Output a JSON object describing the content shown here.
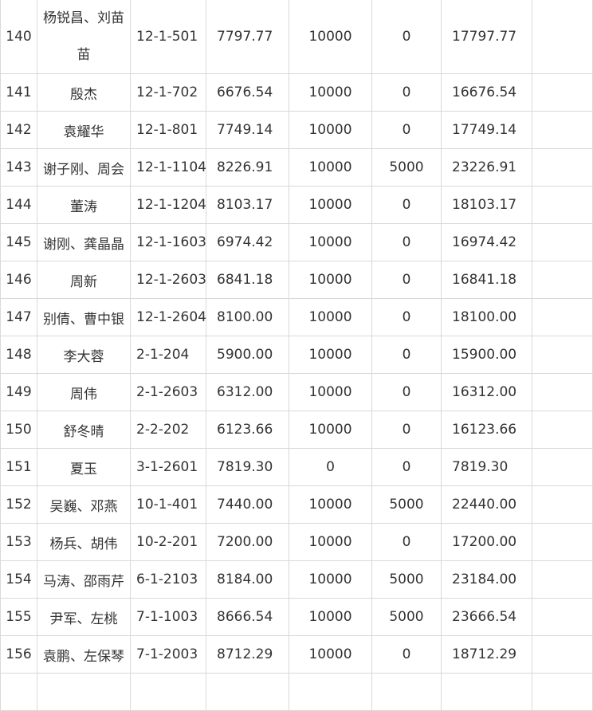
{
  "rows": [
    {
      "no": "140",
      "name": "杨锐昌、刘苗苗",
      "unit": "12-1-501",
      "amount1": "7797.77",
      "amount2": "10000",
      "amount3": "0",
      "total": "17797.77"
    },
    {
      "no": "141",
      "name": "殷杰",
      "unit": "12-1-702",
      "amount1": "6676.54",
      "amount2": "10000",
      "amount3": "0",
      "total": "16676.54"
    },
    {
      "no": "142",
      "name": "袁耀华",
      "unit": "12-1-801",
      "amount1": "7749.14",
      "amount2": "10000",
      "amount3": "0",
      "total": "17749.14"
    },
    {
      "no": "143",
      "name": "谢子刚、周会",
      "unit": "12-1-1104",
      "amount1": "8226.91",
      "amount2": "10000",
      "amount3": "5000",
      "total": "23226.91"
    },
    {
      "no": "144",
      "name": "董涛",
      "unit": "12-1-1204",
      "amount1": "8103.17",
      "amount2": "10000",
      "amount3": "0",
      "total": "18103.17"
    },
    {
      "no": "145",
      "name": "谢刚、龚晶晶",
      "unit": "12-1-1603",
      "amount1": "6974.42",
      "amount2": "10000",
      "amount3": "0",
      "total": "16974.42"
    },
    {
      "no": "146",
      "name": "周新",
      "unit": "12-1-2603",
      "amount1": "6841.18",
      "amount2": "10000",
      "amount3": "0",
      "total": "16841.18"
    },
    {
      "no": "147",
      "name": "别倩、曹中银",
      "unit": "12-1-2604",
      "amount1": "8100.00",
      "amount2": "10000",
      "amount3": "0",
      "total": "18100.00"
    },
    {
      "no": "148",
      "name": "李大蓉",
      "unit": "2-1-204",
      "amount1": "5900.00",
      "amount2": "10000",
      "amount3": "0",
      "total": "15900.00"
    },
    {
      "no": "149",
      "name": "周伟",
      "unit": "2-1-2603",
      "amount1": "6312.00",
      "amount2": "10000",
      "amount3": "0",
      "total": "16312.00"
    },
    {
      "no": "150",
      "name": "舒冬晴",
      "unit": "2-2-202",
      "amount1": "6123.66",
      "amount2": "10000",
      "amount3": "0",
      "total": "16123.66"
    },
    {
      "no": "151",
      "name": "夏玉",
      "unit": "3-1-2601",
      "amount1": "7819.30",
      "amount2": "0",
      "amount3": "0",
      "total": "7819.30"
    },
    {
      "no": "152",
      "name": "吴巍、邓燕",
      "unit": "10-1-401",
      "amount1": "7440.00",
      "amount2": "10000",
      "amount3": "5000",
      "total": "22440.00"
    },
    {
      "no": "153",
      "name": "杨兵、胡伟",
      "unit": "10-2-201",
      "amount1": "7200.00",
      "amount2": "10000",
      "amount3": "0",
      "total": "17200.00"
    },
    {
      "no": "154",
      "name": "马涛、邵雨芹",
      "unit": "6-1-2103",
      "amount1": "8184.00",
      "amount2": "10000",
      "amount3": "5000",
      "total": "23184.00"
    },
    {
      "no": "155",
      "name": "尹军、左桃",
      "unit": "7-1-1003",
      "amount1": "8666.54",
      "amount2": "10000",
      "amount3": "5000",
      "total": "23666.54"
    },
    {
      "no": "156",
      "name": "袁鹏、左保琴",
      "unit": "7-1-2003",
      "amount1": "8712.29",
      "amount2": "10000",
      "amount3": "0",
      "total": "18712.29"
    }
  ]
}
